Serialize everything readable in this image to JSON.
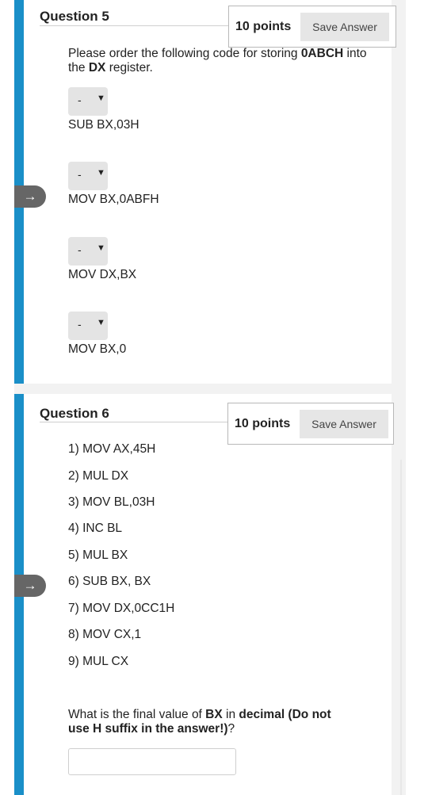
{
  "q5": {
    "title": "Question 5",
    "points": "10 points",
    "save_label": "Save Answer",
    "prompt_a": "Please order the following code for storing ",
    "prompt_b": "0ABCH",
    "prompt_c": " into the ",
    "prompt_d": "DX",
    "prompt_e": " register.",
    "items": [
      {
        "selected": "-",
        "code": "SUB BX,03H"
      },
      {
        "selected": "-",
        "code": "MOV BX,0ABFH"
      },
      {
        "selected": "-",
        "code": "MOV DX,BX"
      },
      {
        "selected": "-",
        "code": "MOV BX,0"
      }
    ]
  },
  "q6": {
    "title": "Question 6",
    "points": "10 points",
    "save_label": "Save Answer",
    "lines": [
      "1) MOV AX,45H",
      "2) MUL DX",
      "3) MOV BL,03H",
      "4) INC BL",
      "5) MUL BX",
      "6) SUB BX, BX",
      "7) MOV DX,0CC1H",
      "8) MOV CX,1",
      "9) MUL CX"
    ],
    "question_a": "What is the final value of ",
    "question_b": "BX",
    "question_c": " in ",
    "question_d": "decimal (Do not use H suffix in the answer!)",
    "question_e": "?",
    "answer_value": ""
  },
  "icons": {
    "nav": "arrow-right-icon",
    "select": "chevron-down-icon"
  },
  "colors": {
    "accent": "#1a8fc8",
    "nav_tab": "#666666",
    "button": "#e6e6e6"
  }
}
